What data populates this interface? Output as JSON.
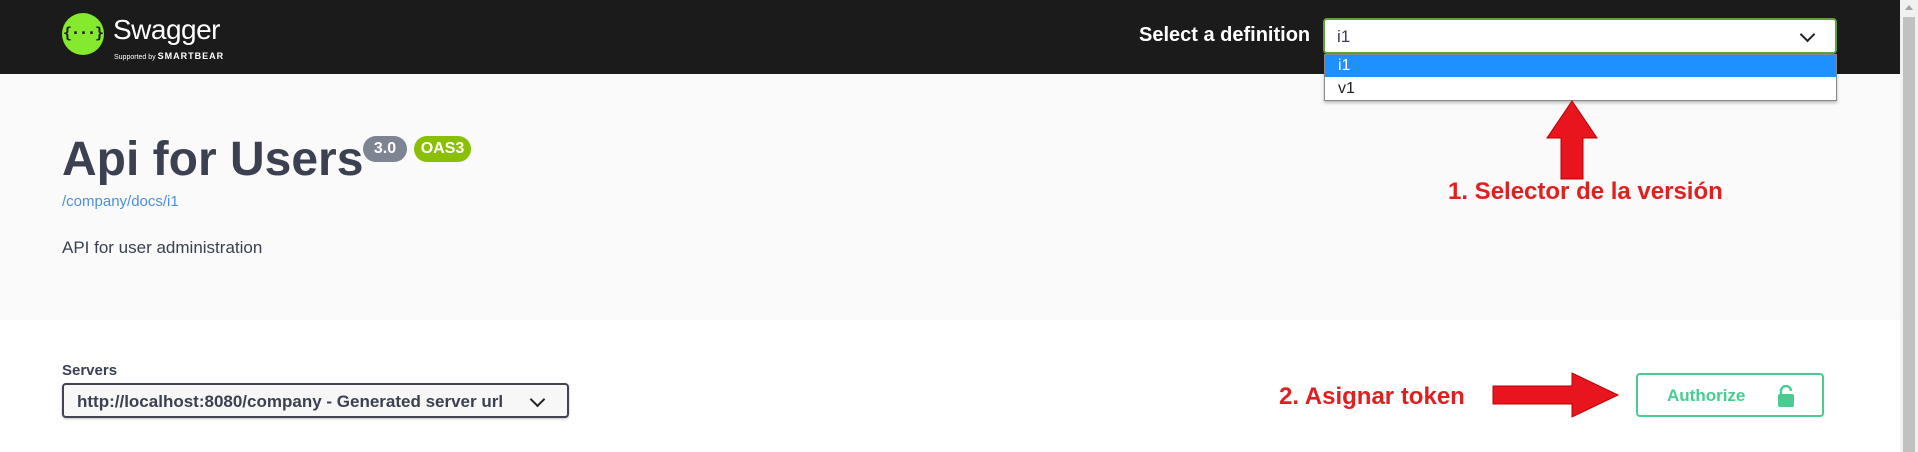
{
  "topbar": {
    "brand": "Swagger",
    "brand_sub_prefix": "Supported by",
    "brand_sub_name": "SMARTBEAR",
    "logo_glyph": "{···}",
    "definition_label": "Select a definition",
    "definition_value": "i1",
    "definition_options": [
      "i1",
      "v1"
    ]
  },
  "info": {
    "title": "Api for Users",
    "version_badge": "3.0",
    "oas_badge": "OAS3",
    "docs_path": "/company/docs/i1",
    "description": "API for user administration"
  },
  "annotations": {
    "note1": "1. Selector de la versión",
    "note2": "2. Asignar token"
  },
  "servers": {
    "label": "Servers",
    "selected": "http://localhost:8080/company - Generated server url"
  },
  "authorize": {
    "label": "Authorize"
  },
  "colors": {
    "topbar": "#1b1b1b",
    "accent_green": "#49cc90",
    "annotation_red": "#e02020",
    "selected_option": "#1e90ff"
  },
  "icons": [
    "swagger-logo-icon",
    "chevron-down-icon",
    "lock-icon",
    "arrow-up-icon",
    "arrow-right-icon"
  ]
}
